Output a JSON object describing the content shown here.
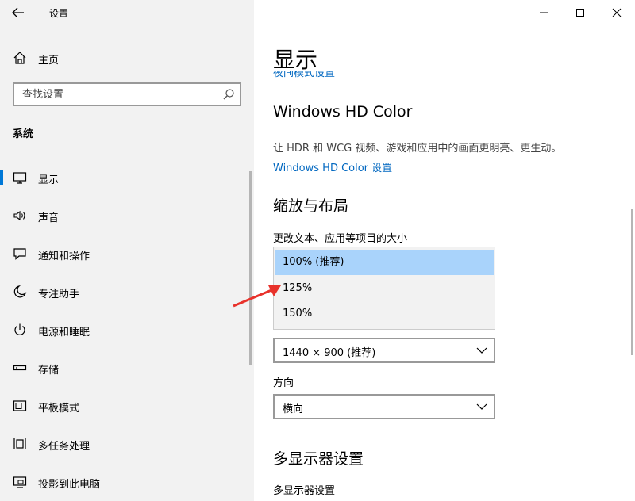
{
  "window": {
    "title": "设置"
  },
  "sidebar": {
    "home_label": "主页",
    "search_placeholder": "查找设置",
    "section_label": "系统",
    "items": [
      {
        "label": "显示",
        "icon": "monitor-icon",
        "active": true
      },
      {
        "label": "声音",
        "icon": "speaker-icon"
      },
      {
        "label": "通知和操作",
        "icon": "notification-icon"
      },
      {
        "label": "专注助手",
        "icon": "moon-icon"
      },
      {
        "label": "电源和睡眠",
        "icon": "power-icon"
      },
      {
        "label": "存储",
        "icon": "storage-icon"
      },
      {
        "label": "平板模式",
        "icon": "tablet-icon"
      },
      {
        "label": "多任务处理",
        "icon": "multitask-icon"
      },
      {
        "label": "投影到此电脑",
        "icon": "project-icon"
      }
    ]
  },
  "main": {
    "title": "显示",
    "night_light_link": "夜间模式设置",
    "hdr": {
      "heading": "Windows HD Color",
      "description": "让 HDR 和 WCG 视频、游戏和应用中的画面更明亮、更生动。",
      "link": "Windows HD Color 设置"
    },
    "scale": {
      "heading": "缩放与布局",
      "label": "更改文本、应用等项目的大小",
      "options": [
        "100% (推荐)",
        "125%",
        "150%"
      ],
      "selected_index": 0
    },
    "resolution": {
      "value": "1440 × 900 (推荐)"
    },
    "orientation": {
      "label": "方向",
      "value": "横向"
    },
    "multi_display": {
      "heading": "多显示器设置",
      "label": "多显示器设置"
    }
  },
  "colors": {
    "accent": "#0078d7",
    "link": "#0067c0",
    "selected_option": "#a9d3fb",
    "annotation_arrow": "#e8322b"
  }
}
